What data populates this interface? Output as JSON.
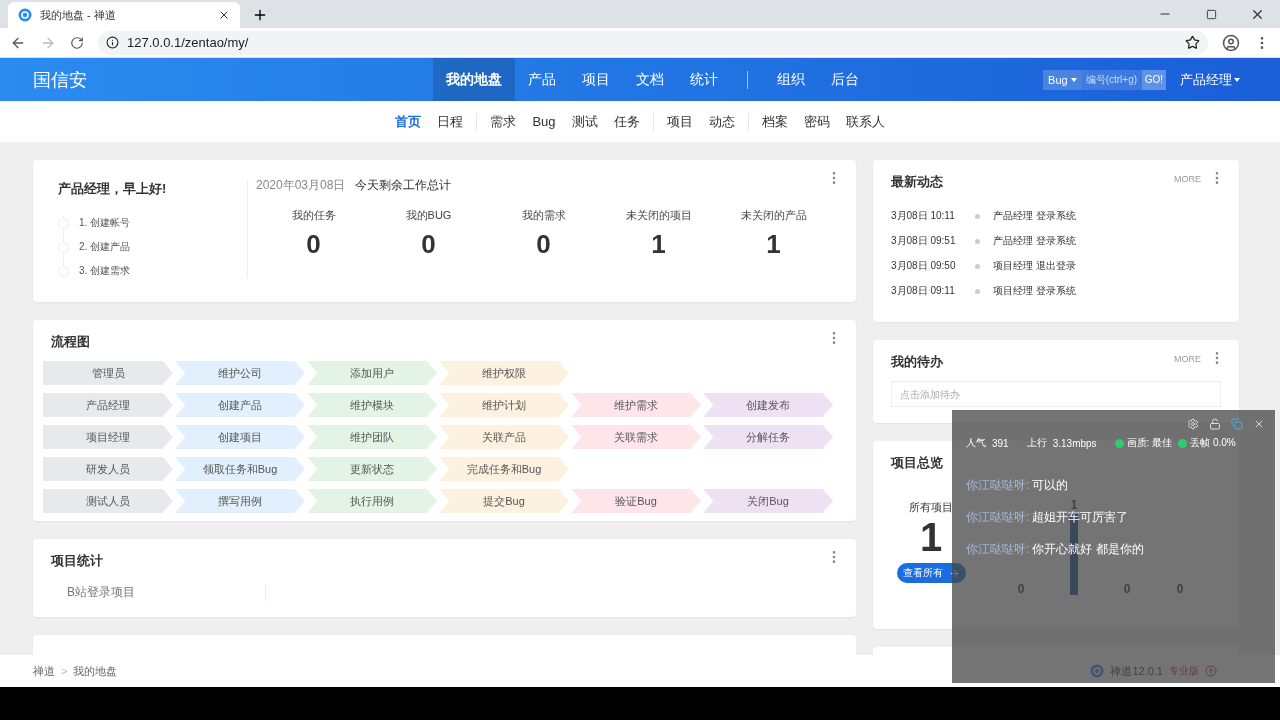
{
  "browser": {
    "tab_title": "我的地盘 - 禅道",
    "url": "127.0.0.1/zentao/my/"
  },
  "header": {
    "logo": "国信安",
    "nav": [
      [
        {
          "label": "我的地盘",
          "selected": true
        },
        {
          "label": "产品",
          "selected": false
        },
        {
          "label": "项目",
          "selected": false
        },
        {
          "label": "文档",
          "selected": false
        },
        {
          "label": "统计",
          "selected": false
        }
      ],
      [
        {
          "label": "组织",
          "selected": false
        },
        {
          "label": "后台",
          "selected": false
        }
      ]
    ],
    "search_type": "Bug",
    "search_placeholder": "编号(ctrl+g)",
    "search_button": "GO!",
    "user": "产品经理"
  },
  "subnav": [
    [
      {
        "label": "首页",
        "selected": true
      },
      {
        "label": "日程",
        "selected": false
      }
    ],
    [
      {
        "label": "需求",
        "selected": false
      },
      {
        "label": "Bug",
        "selected": false
      },
      {
        "label": "测试",
        "selected": false
      },
      {
        "label": "任务",
        "selected": false
      }
    ],
    [
      {
        "label": "项目",
        "selected": false
      },
      {
        "label": "动态",
        "selected": false
      }
    ],
    [
      {
        "label": "档案",
        "selected": false
      },
      {
        "label": "密码",
        "selected": false
      },
      {
        "label": "联系人",
        "selected": false
      }
    ]
  ],
  "welcome": {
    "greeting": "产品经理，早上好!",
    "steps": [
      "1. 创建帐号",
      "2. 创建产品",
      "3. 创建需求"
    ],
    "date": "2020年03月08日",
    "summary_title": "今天剩余工作总计",
    "stats": [
      {
        "label": "我的任务",
        "value": "0"
      },
      {
        "label": "我的BUG",
        "value": "0"
      },
      {
        "label": "我的需求",
        "value": "0"
      },
      {
        "label": "未关闭的项目",
        "value": "1"
      },
      {
        "label": "未关闭的产品",
        "value": "1"
      }
    ]
  },
  "flowchart": {
    "title": "流程图",
    "rows": [
      [
        "管理员",
        "维护公司",
        "添加用户",
        "维护权限"
      ],
      [
        "产品经理",
        "创建产品",
        "维护模块",
        "维护计划",
        "维护需求",
        "创建发布"
      ],
      [
        "项目经理",
        "创建项目",
        "维护团队",
        "关联产品",
        "关联需求",
        "分解任务"
      ],
      [
        "研发人员",
        "领取任务和Bug",
        "更新状态",
        "完成任务和Bug"
      ],
      [
        "测试人员",
        "撰写用例",
        "执行用例",
        "提交Bug",
        "验证Bug",
        "关闭Bug"
      ]
    ]
  },
  "project_stats": {
    "title": "项目统计",
    "projects": [
      "B站登录项目"
    ]
  },
  "activity": {
    "title": "最新动态",
    "more": "MORE",
    "items": [
      {
        "time": "3月08日 10:11",
        "text": "产品经理 登录系统"
      },
      {
        "time": "3月08日 09:51",
        "text": "产品经理 登录系统"
      },
      {
        "time": "3月08日 09:50",
        "text": "项目经理 退出登录"
      },
      {
        "time": "3月08日 09:11",
        "text": "项目经理 登录系统"
      }
    ]
  },
  "todo": {
    "title": "我的待办",
    "more": "MORE",
    "placeholder": "点击添加待办"
  },
  "project_overview": {
    "title": "项目总览",
    "all_label": "所有项目",
    "all_count": "1",
    "button": "查看所有",
    "status_counts": [
      "0",
      "1",
      "0",
      "0"
    ]
  },
  "footer": {
    "breadcrumb": [
      "禅道",
      "我的地盘"
    ],
    "breadcrumb_separator": ">",
    "version": "禅道12.0.1",
    "edition": "专业版"
  },
  "stream_overlay": {
    "stats": [
      {
        "label": "人气",
        "value": "391"
      },
      {
        "label": "上行",
        "value": "3.13mbps"
      }
    ],
    "indicators": [
      {
        "text": "画质: 最佳",
        "color": "#2ecc71"
      },
      {
        "text": "丢帧 0.0%",
        "color": "#2ecc71"
      }
    ],
    "chat": [
      {
        "user": "你江哒哒呀:",
        "message": "可以的"
      },
      {
        "user": "你江哒哒呀:",
        "message": "超姐开车可厉害了"
      },
      {
        "user": "你江哒哒呀:",
        "message": "你开心就好  都是你的"
      }
    ]
  }
}
